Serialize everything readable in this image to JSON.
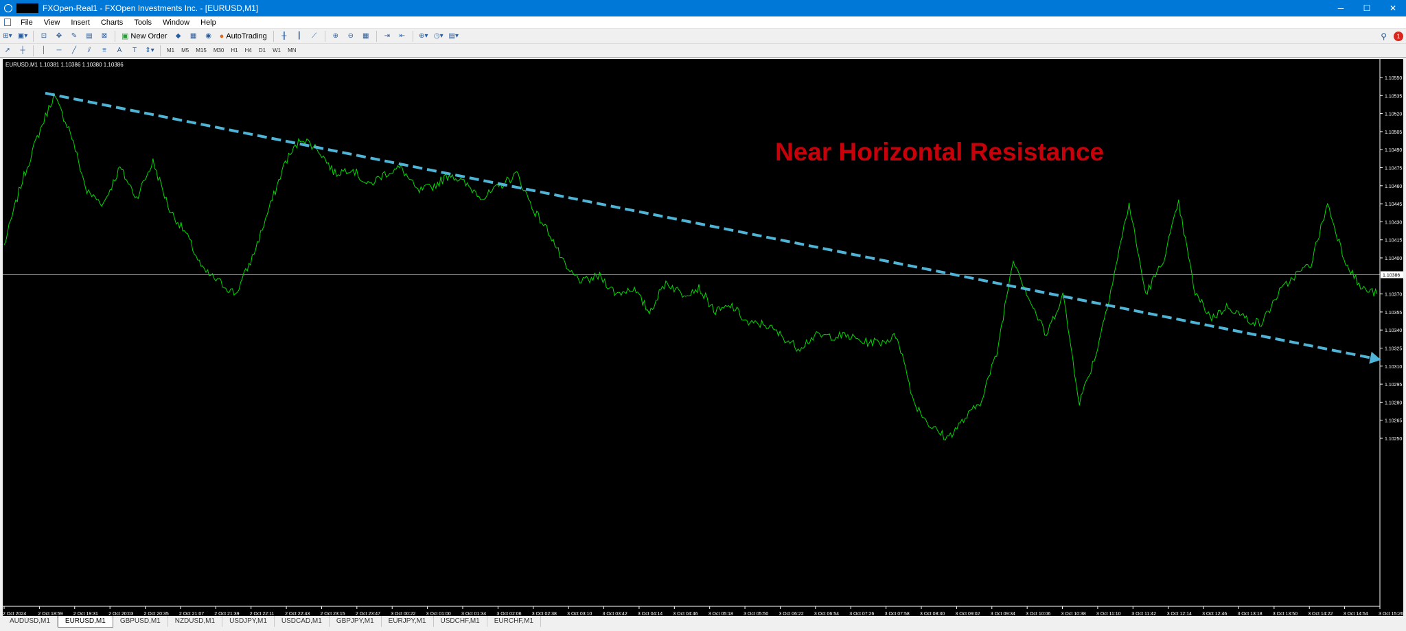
{
  "window": {
    "title": "FXOpen-Real1 - FXOpen Investments Inc. - [EURUSD,M1]",
    "controls": [
      "─",
      "☐",
      "✕"
    ]
  },
  "menu": [
    "File",
    "View",
    "Insert",
    "Charts",
    "Tools",
    "Window",
    "Help"
  ],
  "toolbar": {
    "new_order": "New Order",
    "autotrading": "AutoTrading"
  },
  "timeframes": [
    "M1",
    "M5",
    "M15",
    "M30",
    "H1",
    "H4",
    "D1",
    "W1",
    "MN"
  ],
  "notifications": {
    "count": "1"
  },
  "chart": {
    "header": "EURUSD,M1  1.10381 1.10386 1.10380 1.10386",
    "annotation": "Near Horizontal Resistance",
    "current_price_label": "1.10386",
    "colors": {
      "line": "#00d900",
      "trend": "#4fb4d6",
      "annotation": "#c8000a",
      "background": "#000000"
    }
  },
  "chart_data": {
    "type": "line",
    "ylim": [
      1.1024,
      1.1056
    ],
    "yticks": [
      "1.10550",
      "1.10535",
      "1.10520",
      "1.10505",
      "1.10490",
      "1.10475",
      "1.10460",
      "1.10445",
      "1.10430",
      "1.10415",
      "1.10400",
      "1.10370",
      "1.10355",
      "1.10340",
      "1.10325",
      "1.10310",
      "1.10295",
      "1.10280",
      "1.10265",
      "1.10250"
    ],
    "xticks": [
      "2 Oct 2024",
      "2 Oct 18:59",
      "2 Oct 19:31",
      "2 Oct 20:03",
      "2 Oct 20:35",
      "2 Oct 21:07",
      "2 Oct 21:39",
      "2 Oct 22:11",
      "2 Oct 22:43",
      "2 Oct 23:15",
      "2 Oct 23:47",
      "3 Oct 00:22",
      "3 Oct 01:00",
      "3 Oct 01:34",
      "3 Oct 02:06",
      "3 Oct 02:38",
      "3 Oct 03:10",
      "3 Oct 03:42",
      "3 Oct 04:14",
      "3 Oct 04:46",
      "3 Oct 05:18",
      "3 Oct 05:50",
      "3 Oct 06:22",
      "3 Oct 06:54",
      "3 Oct 07:26",
      "3 Oct 07:58",
      "3 Oct 08:30",
      "3 Oct 09:02",
      "3 Oct 09:34",
      "3 Oct 10:06",
      "3 Oct 10:38",
      "3 Oct 11:10",
      "3 Oct 11:42",
      "3 Oct 12:14",
      "3 Oct 12:46",
      "3 Oct 13:18",
      "3 Oct 13:50",
      "3 Oct 14:22",
      "3 Oct 14:54",
      "3 Oct 15:26"
    ],
    "series": [
      {
        "values": [
          1.1041,
          1.1046,
          1.105,
          1.10535,
          1.10505,
          1.10455,
          1.10445,
          1.10475,
          1.1045,
          1.1048,
          1.1044,
          1.1042,
          1.1039,
          1.1038,
          1.1037,
          1.104,
          1.1044,
          1.1048,
          1.105,
          1.1049,
          1.1047,
          1.10475,
          1.1046,
          1.1047,
          1.10475,
          1.10455,
          1.1046,
          1.1047,
          1.1046,
          1.1045,
          1.1046,
          1.1047,
          1.1044,
          1.1042,
          1.1039,
          1.1038,
          1.10385,
          1.1037,
          1.10375,
          1.10355,
          1.1038,
          1.1037,
          1.10375,
          1.10355,
          1.1036,
          1.10345,
          1.10345,
          1.10335,
          1.10325,
          1.10335,
          1.10335,
          1.10335,
          1.1033,
          1.1033,
          1.10335,
          1.1028,
          1.1026,
          1.1025,
          1.10265,
          1.1028,
          1.1032,
          1.104,
          1.10365,
          1.10335,
          1.1037,
          1.1028,
          1.1032,
          1.1038,
          1.10445,
          1.1037,
          1.10395,
          1.10445,
          1.1037,
          1.1035,
          1.1036,
          1.1035,
          1.10345,
          1.1037,
          1.10385,
          1.10395,
          1.10445,
          1.104,
          1.10375,
          1.1037
        ]
      },
      {
        "name": "trend",
        "values": [
          1.10537,
          1.10317
        ]
      }
    ]
  },
  "symbol_tabs": [
    "AUDUSD,M1",
    "EURUSD,M1",
    "GBPUSD,M1",
    "NZDUSD,M1",
    "USDJPY,M1",
    "USDCAD,M1",
    "GBPJPY,M1",
    "EURJPY,M1",
    "USDCHF,M1",
    "EURCHF,M1"
  ],
  "active_tab": 1
}
